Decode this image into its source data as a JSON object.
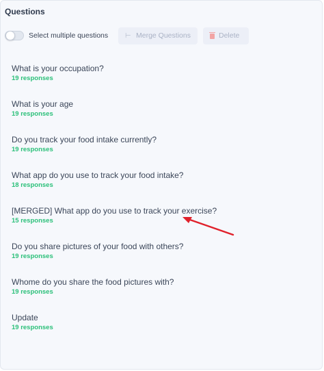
{
  "panel": {
    "title": "Questions"
  },
  "toolbar": {
    "toggle_label": "Select multiple questions",
    "toggle_on": false,
    "merge_icon": "merge-icon",
    "merge_label": "Merge Questions",
    "delete_icon": "trash-icon",
    "delete_label": "Delete"
  },
  "questions": [
    {
      "text": "What is your occupation?",
      "count": "19 responses"
    },
    {
      "text": "What is your age",
      "count": "19 responses"
    },
    {
      "text": "Do you track your food intake currently?",
      "count": "19 responses"
    },
    {
      "text": "What app do you use to track your food intake?",
      "count": "18 responses"
    },
    {
      "text": "[MERGED] What app do you use to track your exercise?",
      "count": "15 responses"
    },
    {
      "text": "Do you share pictures of your food with others?",
      "count": "19 responses"
    },
    {
      "text": "Whome do you share the food pictures with?",
      "count": "19 responses"
    },
    {
      "text": "Update",
      "count": "19 responses"
    }
  ],
  "annotation": {
    "icon": "red-arrow-icon",
    "color": "#e0212b"
  },
  "colors": {
    "accent_green": "#2cc07a",
    "delete_red": "#f2a4a4",
    "background": "#f6f8fc"
  }
}
